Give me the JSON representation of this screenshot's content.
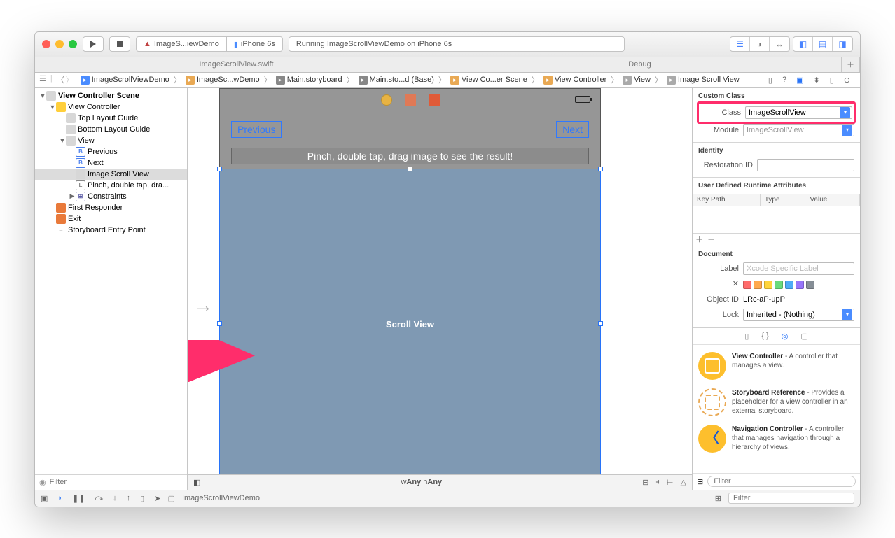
{
  "toolbar": {
    "scheme_app": "ImageS...iewDemo",
    "scheme_device": "iPhone 6s",
    "status": "Running ImageScrollViewDemo on iPhone 6s"
  },
  "tabs": {
    "left": "ImageScrollView.swift",
    "right": "Debug"
  },
  "breadcrumbs": [
    "ImageScrollViewDemo",
    "ImageSc...wDemo",
    "Main.storyboard",
    "Main.sto...d (Base)",
    "View Co...er Scene",
    "View Controller",
    "View",
    "Image Scroll View"
  ],
  "outline": [
    {
      "d": 0,
      "tw": "▼",
      "ic": "gray",
      "txt": "View Controller Scene",
      "bold": true
    },
    {
      "d": 1,
      "tw": "▼",
      "ic": "yellow",
      "txt": "View Controller"
    },
    {
      "d": 2,
      "tw": "",
      "ic": "gray",
      "txt": "Top Layout Guide"
    },
    {
      "d": 2,
      "tw": "",
      "ic": "gray",
      "txt": "Bottom Layout Guide"
    },
    {
      "d": 2,
      "tw": "▼",
      "ic": "gray",
      "txt": "View"
    },
    {
      "d": 3,
      "tw": "",
      "ic": "button",
      "glyph": "B",
      "txt": "Previous"
    },
    {
      "d": 3,
      "tw": "",
      "ic": "button",
      "glyph": "B",
      "txt": "Next"
    },
    {
      "d": 3,
      "tw": "",
      "ic": "gray",
      "txt": "Image Scroll View",
      "sel": true
    },
    {
      "d": 3,
      "tw": "",
      "ic": "label",
      "glyph": "L",
      "txt": "Pinch, double tap, dra..."
    },
    {
      "d": 3,
      "tw": "▶",
      "ic": "square",
      "glyph": "⊞",
      "txt": "Constraints"
    },
    {
      "d": 1,
      "tw": "",
      "ic": "orange",
      "txt": "First Responder"
    },
    {
      "d": 1,
      "tw": "",
      "ic": "orange",
      "txt": "Exit"
    },
    {
      "d": 1,
      "tw": "",
      "ic": "arrow",
      "txt": "Storyboard Entry Point"
    }
  ],
  "nav_filter_placeholder": "Filter",
  "device": {
    "prev": "Previous",
    "next": "Next",
    "label": "Pinch, double tap, drag image to see the result!",
    "scroll": "Scroll View"
  },
  "size": {
    "w_label": "w",
    "w_val": "Any",
    "h_label": "h",
    "h_val": "Any"
  },
  "inspector": {
    "custom_class_title": "Custom Class",
    "class_label": "Class",
    "class_value": "ImageScrollView",
    "module_label": "Module",
    "module_value": "ImageScrollView",
    "identity_title": "Identity",
    "restoration_label": "Restoration ID",
    "udra_title": "User Defined Runtime Attributes",
    "col_keypath": "Key Path",
    "col_type": "Type",
    "col_value": "Value",
    "document_title": "Document",
    "label_label": "Label",
    "label_placeholder": "Xcode Specific Label",
    "objectid_label": "Object ID",
    "objectid_value": "LRc-aP-upP",
    "lock_label": "Lock",
    "lock_value": "Inherited - (Nothing)"
  },
  "library": {
    "items": [
      {
        "title": "View Controller",
        "desc": " - A controller that manages a view.",
        "kind": "vc"
      },
      {
        "title": "Storyboard Reference",
        "desc": " - Provides a placeholder for a view controller in an external storyboard.",
        "kind": "sb"
      },
      {
        "title": "Navigation Controller",
        "desc": " - A controller that manages navigation through a hierarchy of views.",
        "kind": "nc"
      }
    ],
    "filter_placeholder": "Filter"
  },
  "debug_target": "ImageScrollViewDemo"
}
